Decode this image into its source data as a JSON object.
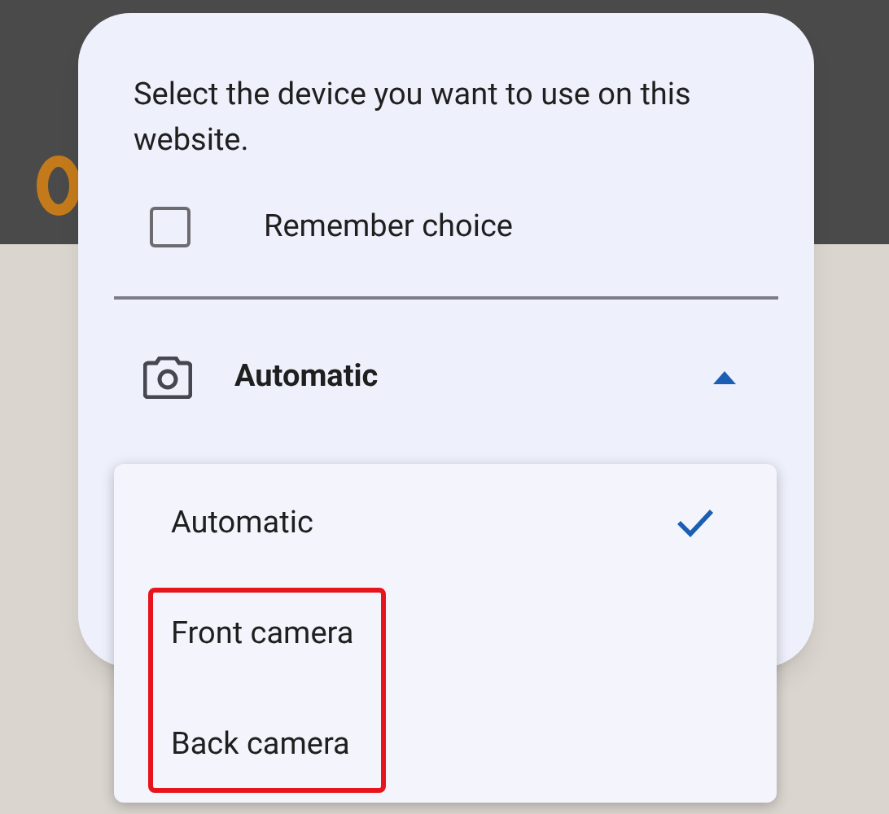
{
  "dialog": {
    "message": "Select the device you want to use on this website.",
    "remember": {
      "label": "Remember choice",
      "checked": false
    },
    "device_picker": {
      "value": "Automatic",
      "expanded": true
    }
  },
  "menu": [
    {
      "label": "Automatic",
      "selected": true,
      "highlighted": false
    },
    {
      "label": "Front camera",
      "selected": false,
      "highlighted": true
    },
    {
      "label": "Back camera",
      "selected": false,
      "highlighted": true
    }
  ]
}
